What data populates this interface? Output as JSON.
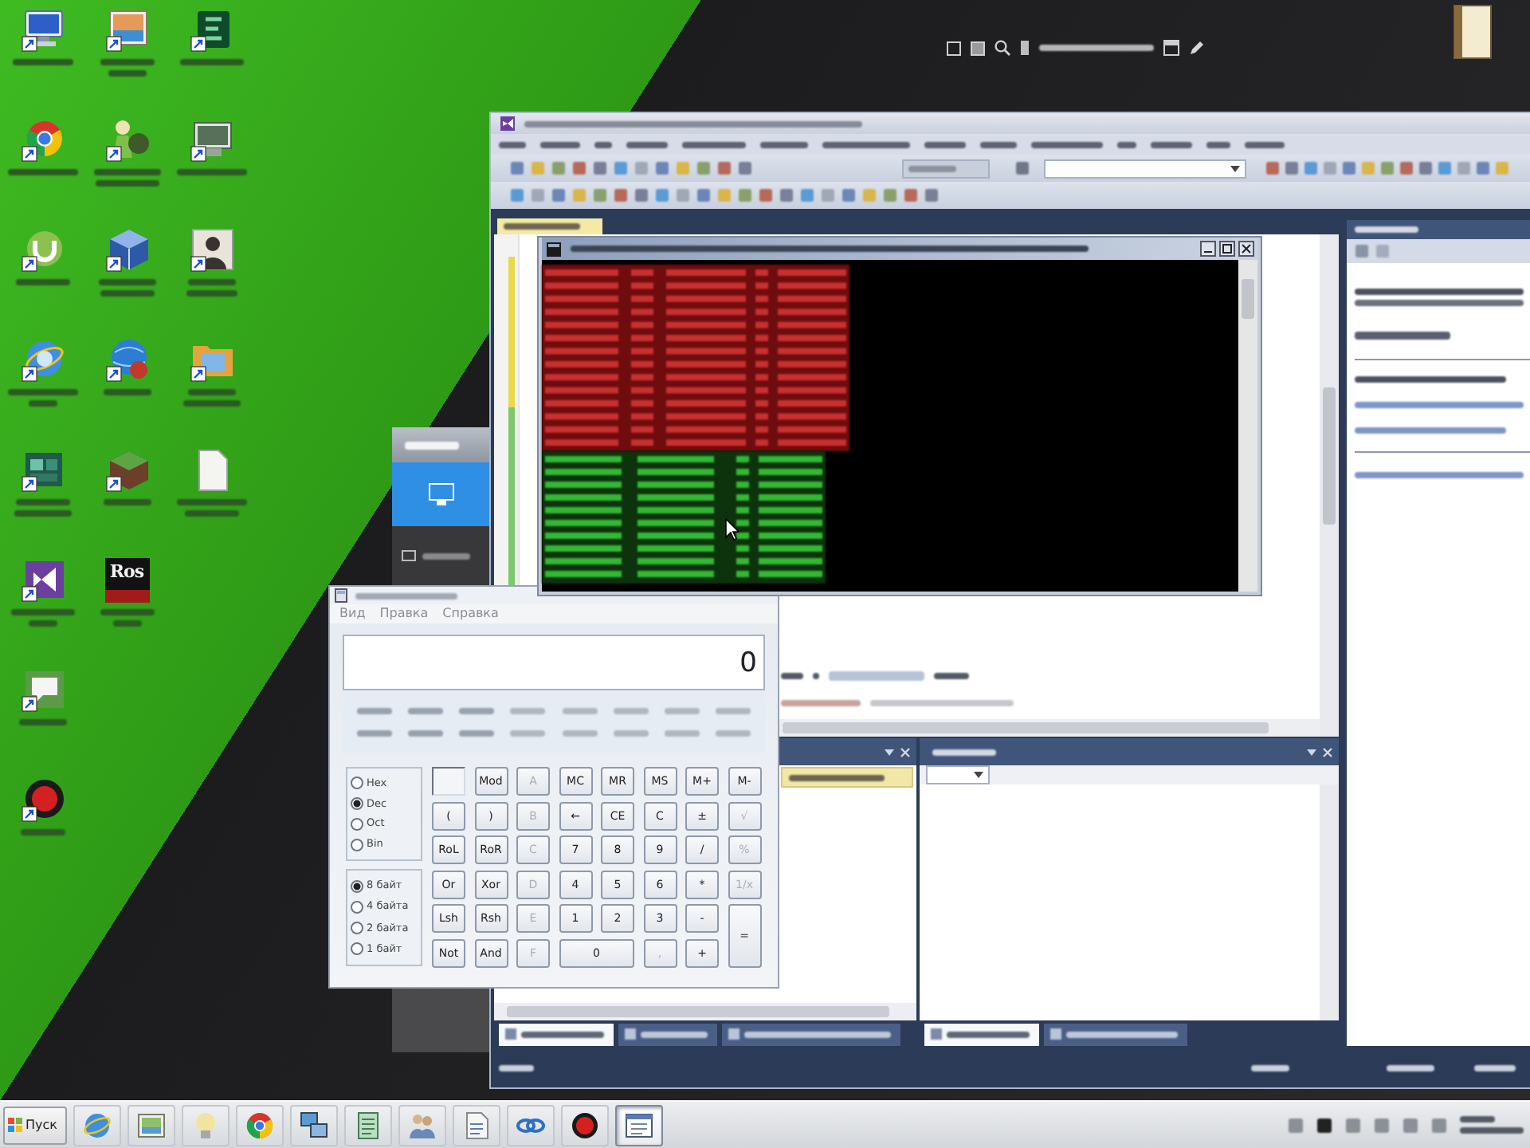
{
  "desktop": {
    "logo_icon_text": "Ros"
  },
  "ide": {
    "document_tabs": [
      {
        "selected": true
      }
    ],
    "left_panel_tabs": [
      {
        "selected": true
      },
      {
        "selected": false
      },
      {
        "selected": false
      }
    ],
    "right_panel_tabs": [
      {
        "selected": true
      },
      {
        "selected": false
      }
    ]
  },
  "calculator": {
    "menu": [
      "Вид",
      "Правка",
      "Справка"
    ],
    "display": "0",
    "radix_options": [
      {
        "label": "Hex",
        "selected": false
      },
      {
        "label": "Dec",
        "selected": true
      },
      {
        "label": "Oct",
        "selected": false
      },
      {
        "label": "Bin",
        "selected": false
      }
    ],
    "word_size_options": [
      {
        "label": "8 байт",
        "selected": true
      },
      {
        "label": "4 байта",
        "selected": false
      },
      {
        "label": "2 байта",
        "selected": false
      },
      {
        "label": "1 байт",
        "selected": false
      }
    ],
    "keys": [
      {
        "label": "Mod",
        "kind": "key",
        "disabled": false
      },
      {
        "label": "A",
        "kind": "key",
        "disabled": true
      },
      {
        "label": "MC",
        "kind": "key",
        "disabled": false
      },
      {
        "label": "MR",
        "kind": "key",
        "disabled": false
      },
      {
        "label": "MS",
        "kind": "key",
        "disabled": false
      },
      {
        "label": "M+",
        "kind": "key",
        "disabled": false
      },
      {
        "label": "M-",
        "kind": "key",
        "disabled": false
      },
      {
        "label": "(",
        "kind": "key",
        "disabled": false
      },
      {
        "label": ")",
        "kind": "key",
        "disabled": false
      },
      {
        "label": "B",
        "kind": "key",
        "disabled": true
      },
      {
        "label": "←",
        "kind": "key",
        "disabled": false
      },
      {
        "label": "CE",
        "kind": "key",
        "disabled": false
      },
      {
        "label": "C",
        "kind": "key",
        "disabled": false
      },
      {
        "label": "±",
        "kind": "key",
        "disabled": false
      },
      {
        "label": "√",
        "kind": "key",
        "disabled": true
      },
      {
        "label": "RoL",
        "kind": "key",
        "disabled": false
      },
      {
        "label": "RoR",
        "kind": "key",
        "disabled": false
      },
      {
        "label": "C",
        "kind": "key",
        "disabled": true
      },
      {
        "label": "7",
        "kind": "key",
        "disabled": false
      },
      {
        "label": "8",
        "kind": "key",
        "disabled": false
      },
      {
        "label": "9",
        "kind": "key",
        "disabled": false
      },
      {
        "label": "/",
        "kind": "key",
        "disabled": false
      },
      {
        "label": "%",
        "kind": "key",
        "disabled": true
      },
      {
        "label": "Or",
        "kind": "key",
        "disabled": false
      },
      {
        "label": "Xor",
        "kind": "key",
        "disabled": false
      },
      {
        "label": "D",
        "kind": "key",
        "disabled": true
      },
      {
        "label": "4",
        "kind": "key",
        "disabled": false
      },
      {
        "label": "5",
        "kind": "key",
        "disabled": false
      },
      {
        "label": "6",
        "kind": "key",
        "disabled": false
      },
      {
        "label": "*",
        "kind": "key",
        "disabled": false
      },
      {
        "label": "1/x",
        "kind": "key",
        "disabled": true
      },
      {
        "label": "Lsh",
        "kind": "key",
        "disabled": false
      },
      {
        "label": "Rsh",
        "kind": "key",
        "disabled": false
      },
      {
        "label": "E",
        "kind": "key",
        "disabled": true
      },
      {
        "label": "1",
        "kind": "key",
        "disabled": false
      },
      {
        "label": "2",
        "kind": "key",
        "disabled": false
      },
      {
        "label": "3",
        "kind": "key",
        "disabled": false
      },
      {
        "label": "-",
        "kind": "key",
        "disabled": false
      },
      {
        "label": "=",
        "kind": "tall",
        "disabled": false
      },
      {
        "label": "Not",
        "kind": "key",
        "disabled": false
      },
      {
        "label": "And",
        "kind": "key",
        "disabled": false
      },
      {
        "label": "F",
        "kind": "key",
        "disabled": true
      },
      {
        "label": "0",
        "kind": "wide",
        "disabled": false
      },
      {
        "label": ",",
        "kind": "key",
        "disabled": true
      },
      {
        "label": "+",
        "kind": "key",
        "disabled": false
      }
    ]
  },
  "taskbar": {
    "start_button": "Пуск",
    "apps": [
      {
        "selected": false
      },
      {
        "selected": false
      },
      {
        "selected": false
      },
      {
        "selected": false
      },
      {
        "selected": false
      },
      {
        "selected": false
      },
      {
        "selected": false
      },
      {
        "selected": false
      },
      {
        "selected": false
      },
      {
        "selected": false
      },
      {
        "selected": true
      }
    ]
  }
}
